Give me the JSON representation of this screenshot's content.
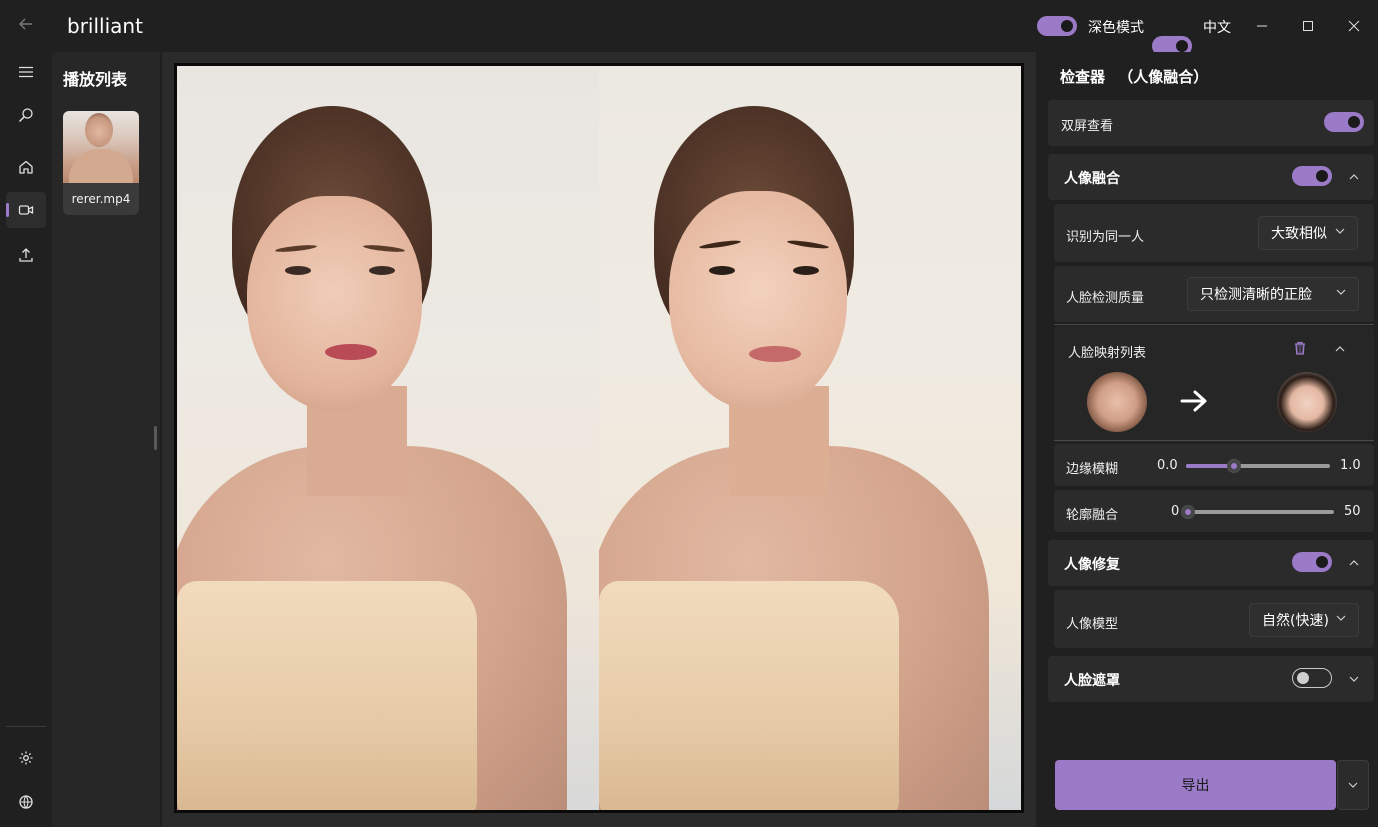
{
  "app": {
    "title": "brilliant"
  },
  "titlebar": {
    "dark_mode_label": "深色模式",
    "dark_mode_on": true,
    "language_label": "中文",
    "language_on": true,
    "minimize_glyph": "—",
    "maximize_glyph": "☐",
    "close_glyph": "✕"
  },
  "nav": {
    "items": [
      {
        "name": "menu",
        "icon": "hamburger-icon"
      },
      {
        "name": "search",
        "icon": "search-icon"
      },
      {
        "name": "home",
        "icon": "home-icon"
      },
      {
        "name": "video",
        "icon": "video-camera-icon",
        "active": true
      },
      {
        "name": "upload",
        "icon": "upload-icon"
      },
      {
        "name": "settings",
        "icon": "gear-icon"
      },
      {
        "name": "language",
        "icon": "globe-icon"
      }
    ]
  },
  "playlist": {
    "title": "播放列表",
    "items": [
      {
        "label": "rerer.mp4"
      }
    ]
  },
  "inspector": {
    "title": "检查器",
    "subtitle": "（人像融合）",
    "dual_screen": {
      "label": "双屏查看",
      "on": true
    },
    "face_fusion": {
      "label": "人像融合",
      "on": true,
      "expanded": true,
      "same_person": {
        "label": "识别为同一人",
        "value": "大致相似"
      },
      "detect_quality": {
        "label": "人脸检测质量",
        "value": "只检测清晰的正脸"
      },
      "mapping_list": {
        "label": "人脸映射列表"
      },
      "edge_blur": {
        "label": "边缘模糊",
        "min": "0.0",
        "max": "1.0",
        "value": 0.33
      },
      "contour_blend": {
        "label": "轮廓融合",
        "min": "0",
        "max": "50",
        "value": 0
      }
    },
    "face_restore": {
      "label": "人像修复",
      "on": true,
      "expanded": true,
      "model": {
        "label": "人像模型",
        "value": "自然(快速)"
      }
    },
    "face_mask": {
      "label": "人脸遮罩",
      "on": false,
      "expanded": false
    },
    "export_label": "导出"
  },
  "colors": {
    "accent": "#9b7bc8",
    "background": "#202020",
    "card": "#2b2b2b"
  }
}
